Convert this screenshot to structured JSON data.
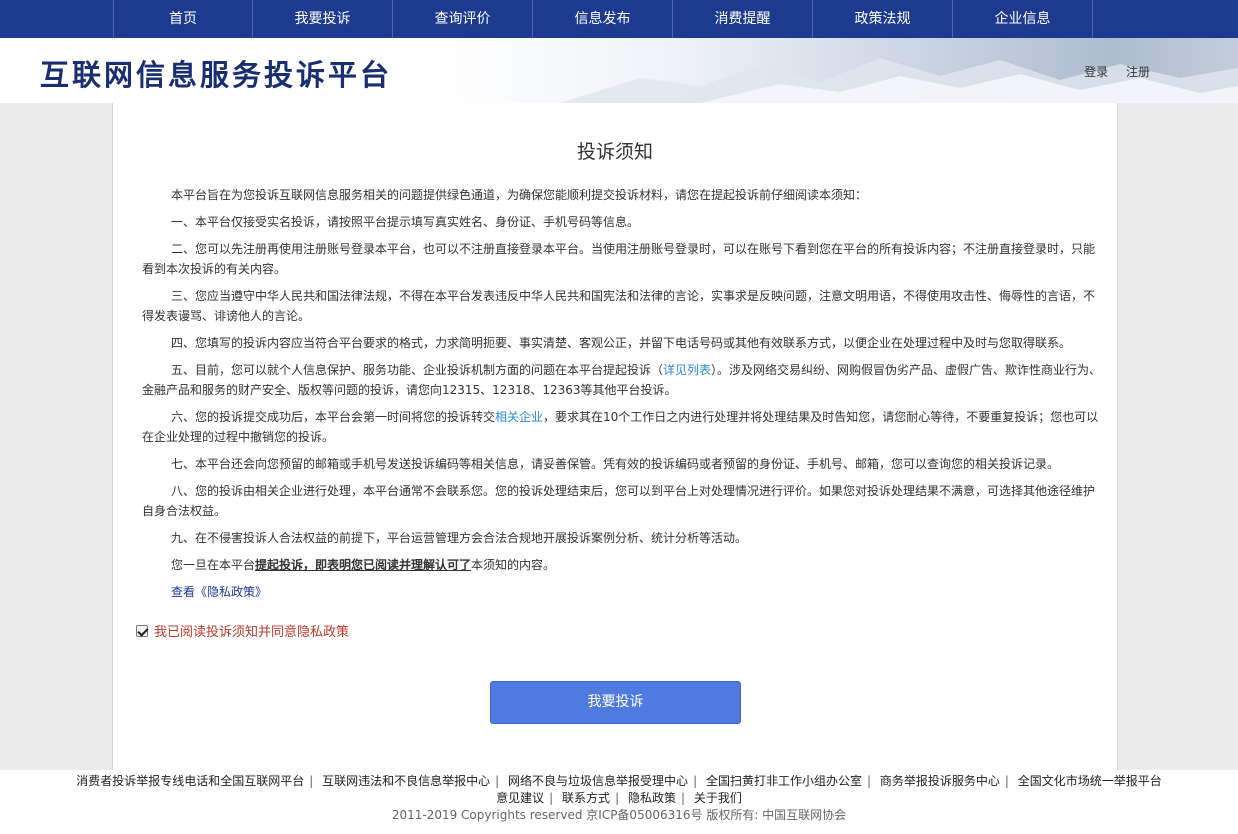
{
  "nav": {
    "items": [
      "首页",
      "我要投诉",
      "查询评价",
      "信息发布",
      "消费提醒",
      "政策法规",
      "企业信息"
    ]
  },
  "header": {
    "site_title": "互联网信息服务投诉平台",
    "login": "登录",
    "register": "注册"
  },
  "notice": {
    "title": "投诉须知",
    "intro": "本平台旨在为您投诉互联网信息服务相关的问题提供绿色通道，为确保您能顺利提交投诉材料，请您在提起投诉前仔细阅读本须知：",
    "item1": "一、本平台仅接受实名投诉，请按照平台提示填写真实姓名、身份证、手机号码等信息。",
    "item2": "二、您可以先注册再使用注册账号登录本平台，也可以不注册直接登录本平台。当使用注册账号登录时，可以在账号下看到您在平台的所有投诉内容；不注册直接登录时，只能看到本次投诉的有关内容。",
    "item3": "三、您应当遵守中华人民共和国法律法规，不得在本平台发表违反中华人民共和国宪法和法律的言论，实事求是反映问题，注意文明用语，不得使用攻击性、侮辱性的言语，不得发表谩骂、诽谤他人的言论。",
    "item4": "四、您填写的投诉内容应当符合平台要求的格式，力求简明扼要、事实清楚、客观公正，并留下电话号码或其他有效联系方式，以便企业在处理过程中及时与您取得联系。",
    "item5_a": "五、目前，您可以就个人信息保护、服务功能、企业投诉机制方面的问题在本平台提起投诉（",
    "item5_link": "详见列表",
    "item5_b": "）。涉及网络交易纠纷、网购假冒伪劣产品、虚假广告、欺诈性商业行为、金融产品和服务的财产安全、版权等问题的投诉，请您向12315、12318、12363等其他平台投诉。",
    "item6_a": "六、您的投诉提交成功后，本平台会第一时间将您的投诉转交",
    "item6_link": "相关企业",
    "item6_b": "，要求其在10个工作日之内进行处理并将处理结果及时告知您，请您耐心等待，不要重复投诉；您也可以在企业处理的过程中撤销您的投诉。",
    "item7": "七、本平台还会向您预留的邮箱或手机号发送投诉编码等相关信息，请妥善保管。凭有效的投诉编码或者预留的身份证、手机号、邮箱，您可以查询您的相关投诉记录。",
    "item8": "八、您的投诉由相关企业进行处理，本平台通常不会联系您。您的投诉处理结束后，您可以到平台上对处理情况进行评价。如果您对投诉处理结果不满意，可选择其他途径维护自身合法权益。",
    "item9": "九、在不侵害投诉人合法权益的前提下，平台运营管理方会合法合规地开展投诉案例分析、统计分析等活动。",
    "closing_a": "您一旦在本平台",
    "closing_strong": "提起投诉，即表明您已阅读并理解认可了",
    "closing_b": "本须知的内容。",
    "privacy_link": "查看《隐私政策》"
  },
  "agree": {
    "label": "我已阅读投诉须知并同意隐私政策",
    "checked": true
  },
  "submit_label": "我要投诉",
  "footer": {
    "links_row1": [
      "消费者投诉举报专线电话和全国互联网平台",
      "互联网违法和不良信息举报中心",
      "网络不良与垃圾信息举报受理中心",
      "全国扫黄打非工作小组办公室",
      "商务举报投诉服务中心",
      "全国文化市场统一举报平台"
    ],
    "links_row2": [
      "意见建议",
      "联系方式",
      "隐私政策",
      "关于我们"
    ],
    "copyright": "2011-2019 Copyrights reserved 京ICP备05006316号  版权所有: 中国互联网协会"
  },
  "colors": {
    "nav_bg": "#1c3a8f",
    "title_color": "#1a2f72",
    "link": "#2a8ad8",
    "agree_text": "#c0392b",
    "submit_bg": "#4f7be0"
  }
}
